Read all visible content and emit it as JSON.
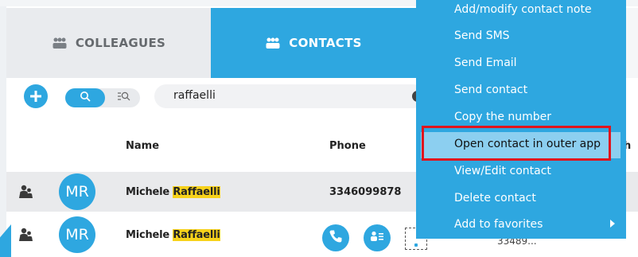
{
  "tabs": {
    "colleagues": "COLLEAGUES",
    "contacts": "CONTACTS"
  },
  "search": {
    "query": "raffaelli"
  },
  "table": {
    "headers": {
      "name": "Name",
      "phone": "Phone",
      "phone_cut": "h"
    },
    "rows": [
      {
        "initials": "MR",
        "name_first": "Michele",
        "name_match": "Raffaelli",
        "phone": "3346099878"
      },
      {
        "initials": "MR",
        "name_first": "Michele",
        "name_match": "Raffaelli",
        "phone_truncated": "33489..."
      }
    ]
  },
  "context_menu": {
    "items": [
      "Add/modify contact note",
      "Send SMS",
      "Send Email",
      "Send contact",
      "Copy the number",
      "Open contact in outer app",
      "View/Edit contact",
      "Delete contact",
      "Add to favorites"
    ],
    "highlighted_index": 5
  },
  "colors": {
    "accent": "#2ea7e0",
    "highlight_text": "#f7d21b",
    "menu_hover": "#8ccff0",
    "annotation_red": "#e0141d"
  },
  "icons": {
    "tab": "people-icon",
    "add": "plus-icon",
    "search": "search-icon",
    "advanced_search": "advanced-search-icon",
    "row_type": "person-icon",
    "call": "phone-icon",
    "card": "contact-card-icon",
    "submenu": "chevron-right-icon"
  }
}
